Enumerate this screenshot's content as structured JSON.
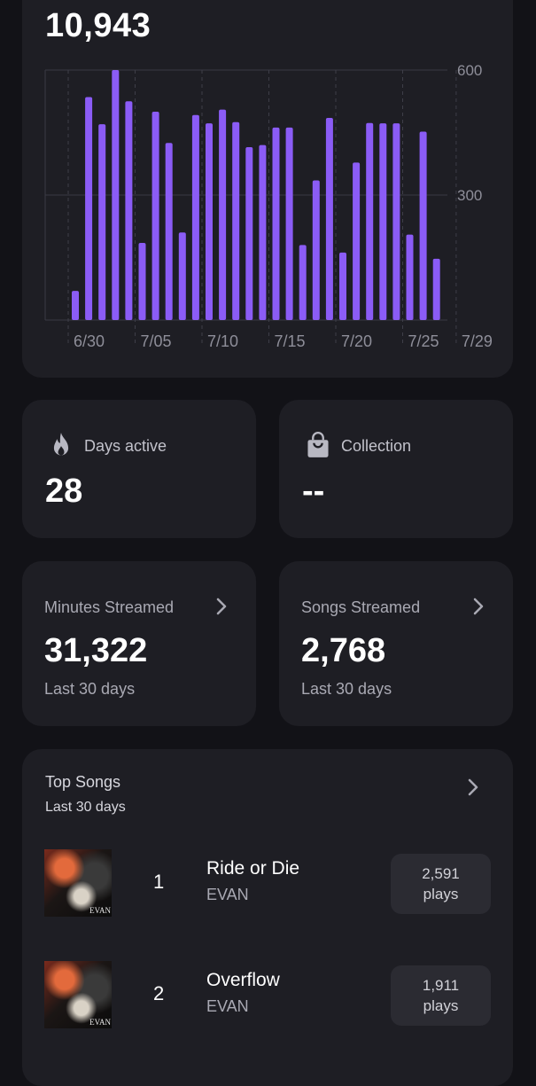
{
  "chart_card": {
    "total_minutes": "10,943"
  },
  "chart_data": {
    "type": "bar",
    "x_tick_labels": [
      "6/30",
      "7/05",
      "7/10",
      "7/15",
      "7/20",
      "7/25",
      "7/29"
    ],
    "y_tick_labels": [
      "600",
      "300"
    ],
    "ylim": [
      0,
      600
    ],
    "grid": true,
    "bar_color": "#8b5cf6",
    "values": [
      70,
      535,
      470,
      600,
      525,
      185,
      500,
      425,
      210,
      492,
      472,
      505,
      475,
      415,
      420,
      462,
      462,
      180,
      335,
      485,
      162,
      378,
      473,
      472,
      472,
      205,
      452,
      147
    ]
  },
  "days_active": {
    "label": "Days active",
    "value": "28",
    "icon": "flame-icon"
  },
  "collection": {
    "label": "Collection",
    "value": "--",
    "icon": "bag-icon"
  },
  "minutes_streamed": {
    "label": "Minutes Streamed",
    "value": "31,322",
    "sub": "Last 30 days"
  },
  "songs_streamed": {
    "label": "Songs Streamed",
    "value": "2,768",
    "sub": "Last 30 days"
  },
  "top_songs": {
    "title": "Top Songs",
    "sub": "Last 30 days",
    "items": [
      {
        "rank": "1",
        "title": "Ride or Die",
        "artist": "EVAN",
        "plays": "2,591",
        "plays_unit": "plays",
        "cover_text": "EVAN"
      },
      {
        "rank": "2",
        "title": "Overflow",
        "artist": "EVAN",
        "plays": "1,911",
        "plays_unit": "plays",
        "cover_text": "EVAN"
      }
    ]
  },
  "colors": {
    "background": "#121217",
    "card": "#1e1e24",
    "accent": "#8b5cf6"
  }
}
